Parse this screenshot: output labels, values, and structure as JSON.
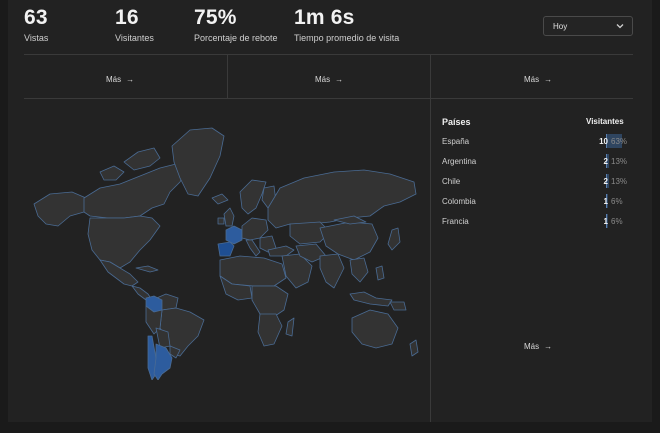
{
  "stats": [
    {
      "value": "63",
      "label": "Vistas"
    },
    {
      "value": "16",
      "label": "Visitantes"
    },
    {
      "value": "75%",
      "label": "Porcentaje de rebote"
    },
    {
      "value": "1m 6s",
      "label": "Tiempo promedio de visita"
    }
  ],
  "period_select": {
    "value": "Hoy",
    "icon": "chevron-down-icon"
  },
  "more_links": {
    "label": "Más",
    "icon": "arrow-right-icon"
  },
  "countries": {
    "title": "Países",
    "column_header": "Visitantes",
    "rows": [
      {
        "name": "España",
        "count": "10",
        "percent": "63%",
        "share": 0.63
      },
      {
        "name": "Argentina",
        "count": "2",
        "percent": "13%",
        "share": 0.13
      },
      {
        "name": "Chile",
        "count": "2",
        "percent": "13%",
        "share": 0.13
      },
      {
        "name": "Colombia",
        "count": "1",
        "percent": "6%",
        "share": 0.06
      },
      {
        "name": "Francia",
        "count": "1",
        "percent": "6%",
        "share": 0.06
      }
    ]
  },
  "colors": {
    "background": "#222222",
    "country_fill": "#333333",
    "country_border": "#4a6b93",
    "highlight_strong": "#1f4f93",
    "highlight_light": "#2d5c9e"
  }
}
